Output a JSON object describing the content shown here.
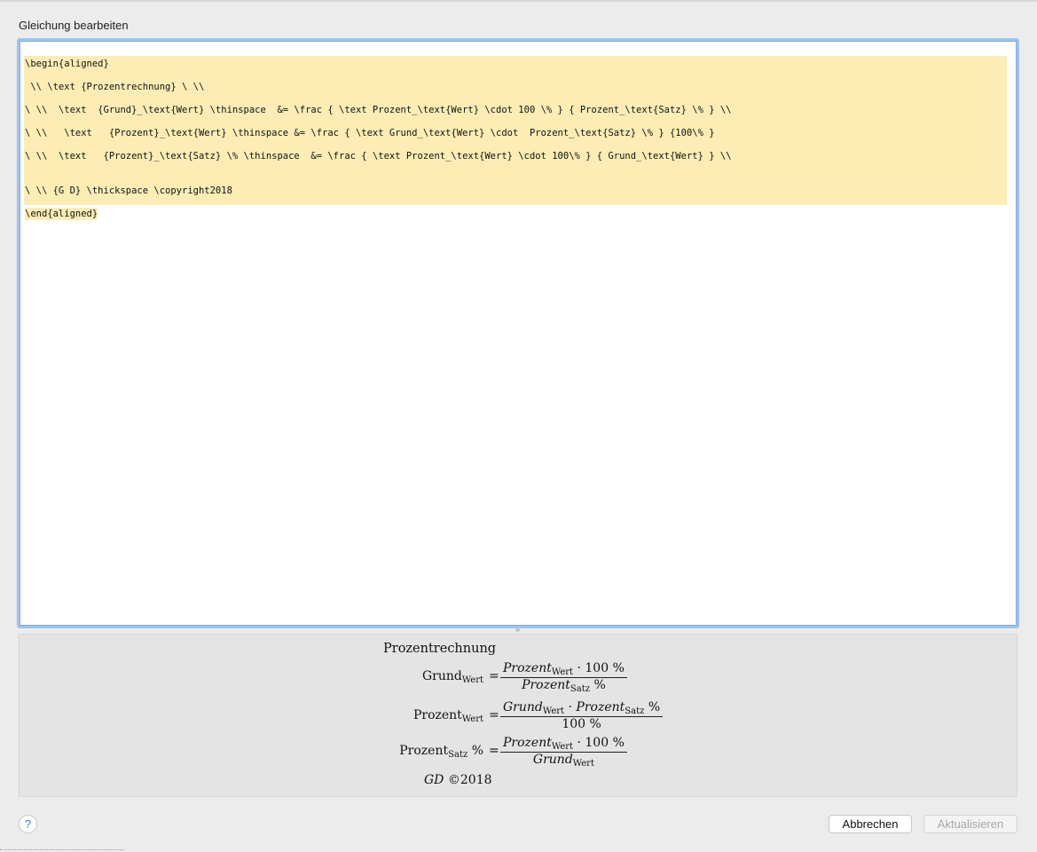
{
  "dialog": {
    "title": "Gleichung bearbeiten"
  },
  "editor": {
    "lines": [
      "\\begin{aligned}",
      " \\\\ \\text {Prozentrechnung} \\ \\\\",
      "\\ \\\\  \\text  {Grund}_\\text{Wert} \\thinspace  &= \\frac { \\text Prozent_\\text{Wert} \\cdot 100 \\% } { Prozent_\\text{Satz} \\% } \\\\",
      "\\ \\\\   \\text   {Prozent}_\\text{Wert} \\thinspace &= \\frac { \\text Grund_\\text{Wert} \\cdot  Prozent_\\text{Satz} \\% } {100\\% }",
      "\\ \\\\  \\text   {Prozent}_\\text{Satz} \\% \\thinspace  &= \\frac { \\text Prozent_\\text{Wert} \\cdot 100\\% } { Grund_\\text{Wert} } \\\\",
      "",
      "\\ \\\\ {G D} \\thickspace \\copyright2018",
      "\\end{aligned}"
    ]
  },
  "preview": {
    "title": "Prozentrechnung",
    "eq1": {
      "lhs_main": "Grund",
      "lhs_sub": "Wert",
      "num_a": "Prozent",
      "num_a_sub": "Wert",
      "num_b": "· 100 %",
      "den_a": "Prozent",
      "den_a_sub": "Satz",
      "den_b": "%"
    },
    "eq2": {
      "lhs_main": "Prozent",
      "lhs_sub": "Wert",
      "num_a": "Grund",
      "num_a_sub": "Wert",
      "num_mid": "·",
      "num_b": "Prozent",
      "num_b_sub": "Satz",
      "num_c": "%",
      "den": "100 %"
    },
    "eq3": {
      "lhs_main": "Prozent",
      "lhs_sub": "Satz",
      "lhs_tail": "%",
      "num_a": "Prozent",
      "num_a_sub": "Wert",
      "num_b": "· 100 %",
      "den_a": "Grund",
      "den_a_sub": "Wert"
    },
    "equals": "=",
    "signature_it": "GD",
    "signature_rest": "©2018"
  },
  "buttons": {
    "help": "?",
    "cancel": "Abbrechen",
    "update": "Aktualisieren"
  }
}
